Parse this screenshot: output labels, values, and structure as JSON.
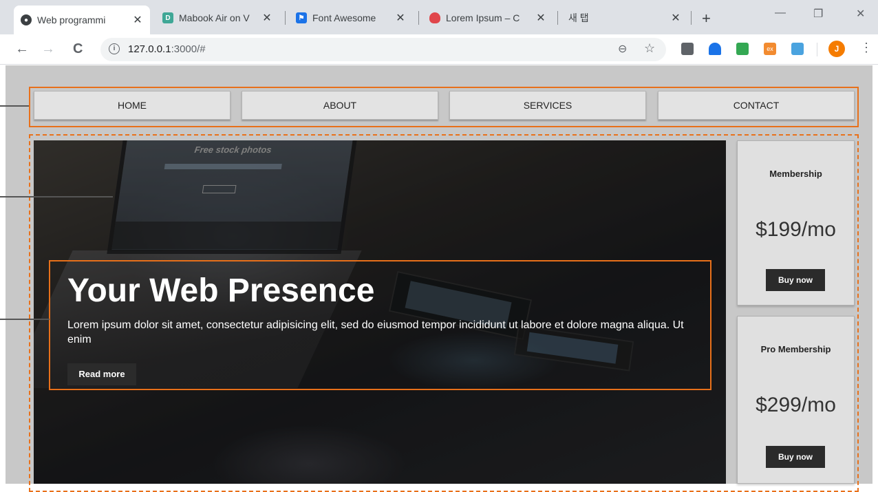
{
  "browser": {
    "tabs": [
      {
        "title": "Web programmi",
        "active": true,
        "favicon": "github-icon"
      },
      {
        "title": "Mabook Air on V",
        "active": false,
        "favicon": "dribbble-d-icon"
      },
      {
        "title": "Font Awesome",
        "active": false,
        "favicon": "flag-icon"
      },
      {
        "title": "Lorem Ipsum – C",
        "active": false,
        "favicon": "lorem-icon"
      },
      {
        "title": "새 탭",
        "active": false,
        "favicon": ""
      }
    ],
    "address": {
      "host": "127.0.0.1",
      "rest": ":3000/#"
    },
    "avatar_letter": "J",
    "extension_labels": [
      "ex"
    ]
  },
  "nav": {
    "items": [
      "HOME",
      "ABOUT",
      "SERVICES",
      "CONTACT"
    ]
  },
  "hero": {
    "laptop_screen_title": "Free stock photos",
    "title": "Your Web Presence",
    "text": "Lorem ipsum dolor sit amet, consectetur adipisicing elit, sed do eiusmod tempor incididunt ut labore et dolore magna aliqua. Ut enim",
    "button": "Read more"
  },
  "pricing": [
    {
      "name": "Membership",
      "price": "$199/mo",
      "button": "Buy now"
    },
    {
      "name": "Pro Membership",
      "price": "$299/mo",
      "button": "Buy now"
    }
  ],
  "colors": {
    "accent_outline": "#e8701a",
    "page_bg": "#c8c8c8",
    "dark_button": "#2b2b2b"
  }
}
